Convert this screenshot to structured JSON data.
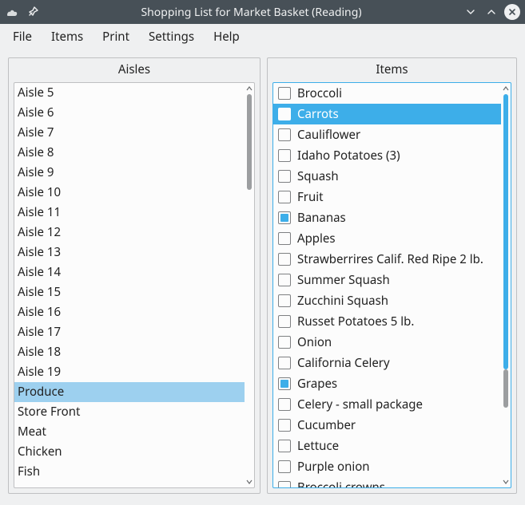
{
  "window": {
    "title": "Shopping List for Market Basket (Reading)"
  },
  "menu": {
    "file": "File",
    "items": "Items",
    "print": "Print",
    "settings": "Settings",
    "help": "Help"
  },
  "panels": {
    "aisles_title": "Aisles",
    "items_title": "Items"
  },
  "aisles": [
    {
      "label": "Aisle 5",
      "selected": false
    },
    {
      "label": "Aisle 6",
      "selected": false
    },
    {
      "label": "Aisle 7",
      "selected": false
    },
    {
      "label": "Aisle 8",
      "selected": false
    },
    {
      "label": "Aisle 9",
      "selected": false
    },
    {
      "label": "Aisle 10",
      "selected": false
    },
    {
      "label": "Aisle 11",
      "selected": false
    },
    {
      "label": "Aisle 12",
      "selected": false
    },
    {
      "label": "Aisle 13",
      "selected": false
    },
    {
      "label": "Aisle 14",
      "selected": false
    },
    {
      "label": "Aisle 15",
      "selected": false
    },
    {
      "label": "Aisle 16",
      "selected": false
    },
    {
      "label": "Aisle 17",
      "selected": false
    },
    {
      "label": "Aisle 18",
      "selected": false
    },
    {
      "label": "Aisle 19",
      "selected": false
    },
    {
      "label": "Produce",
      "selected": true
    },
    {
      "label": "Store Front",
      "selected": false
    },
    {
      "label": "Meat",
      "selected": false
    },
    {
      "label": "Chicken",
      "selected": false
    },
    {
      "label": "Fish",
      "selected": false
    }
  ],
  "items": [
    {
      "label": "Broccoli",
      "checked": false,
      "selected": false
    },
    {
      "label": "Carrots",
      "checked": false,
      "selected": true
    },
    {
      "label": "Cauliflower",
      "checked": false,
      "selected": false
    },
    {
      "label": "Idaho Potatoes (3)",
      "checked": false,
      "selected": false
    },
    {
      "label": "Squash",
      "checked": false,
      "selected": false
    },
    {
      "label": "Fruit",
      "checked": false,
      "selected": false
    },
    {
      "label": "Bananas",
      "checked": true,
      "selected": false
    },
    {
      "label": "Apples",
      "checked": false,
      "selected": false
    },
    {
      "label": "Strawberrires Calif. Red Ripe 2 lb.",
      "checked": false,
      "selected": false
    },
    {
      "label": "Summer Squash",
      "checked": false,
      "selected": false
    },
    {
      "label": "Zucchini Squash",
      "checked": false,
      "selected": false
    },
    {
      "label": "Russet Potatoes 5 lb.",
      "checked": false,
      "selected": false
    },
    {
      "label": "Onion",
      "checked": false,
      "selected": false
    },
    {
      "label": "California Celery",
      "checked": false,
      "selected": false
    },
    {
      "label": "Grapes",
      "checked": true,
      "selected": false
    },
    {
      "label": "Celery - small package",
      "checked": false,
      "selected": false
    },
    {
      "label": "Cucumber",
      "checked": false,
      "selected": false
    },
    {
      "label": "Lettuce",
      "checked": false,
      "selected": false
    },
    {
      "label": "Purple onion",
      "checked": false,
      "selected": false
    },
    {
      "label": "Broccoli crowns",
      "checked": false,
      "selected": false
    }
  ]
}
